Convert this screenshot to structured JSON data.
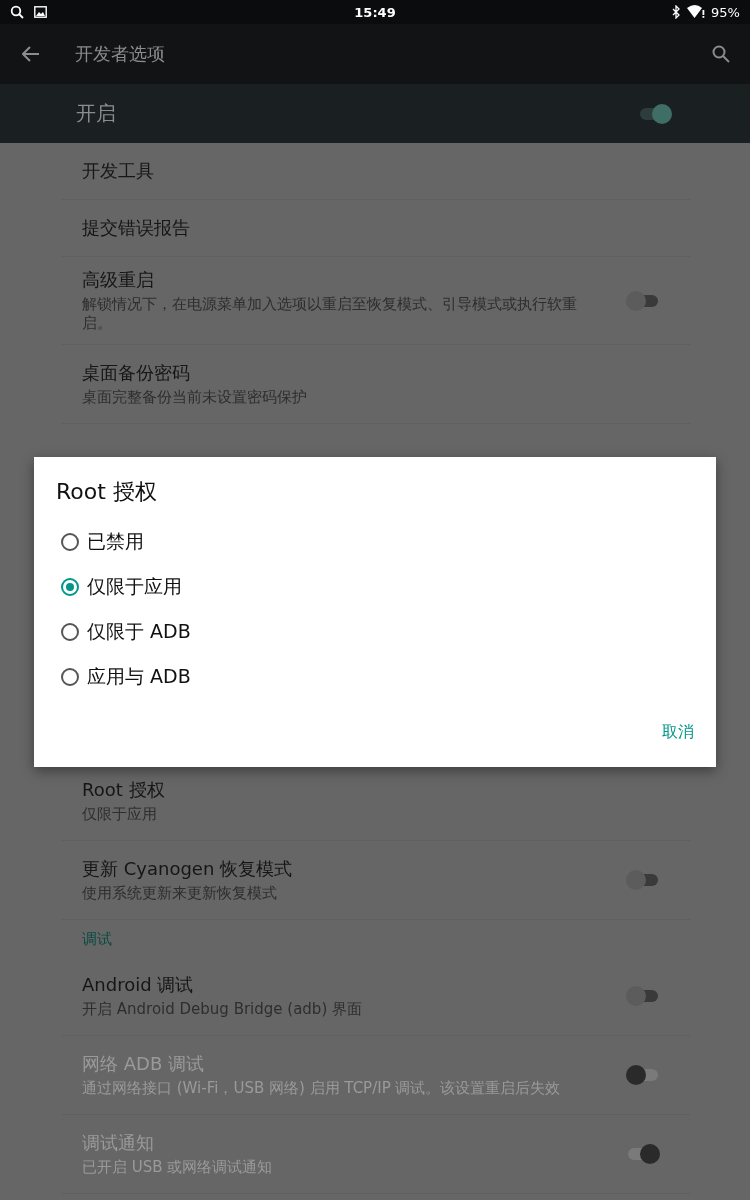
{
  "status_bar": {
    "time": "15:49",
    "battery": "95%"
  },
  "toolbar": {
    "title": "开发者选项"
  },
  "master_switch": {
    "label": "开启",
    "on": true
  },
  "settings": [
    {
      "kind": "row",
      "title": "开发工具"
    },
    {
      "kind": "row",
      "title": "提交错误报告"
    },
    {
      "kind": "switch",
      "title": "高级重启",
      "summary": "解锁情况下，在电源菜单加入选项以重启至恢复模式、引导模式或执行软重启。",
      "on": false,
      "disabled": false
    },
    {
      "kind": "row",
      "title": "桌面备份密码",
      "summary": "桌面完整备份当前未设置密码保护"
    },
    {
      "kind": "hidden"
    },
    {
      "kind": "row",
      "title": "Root 授权",
      "summary": "仅限于应用"
    },
    {
      "kind": "switch",
      "title": "更新 Cyanogen 恢复模式",
      "summary": "使用系统更新来更新恢复模式",
      "on": false,
      "disabled": false
    },
    {
      "kind": "category",
      "title": "调试"
    },
    {
      "kind": "switch",
      "title": "Android 调试",
      "summary": "开启 Android Debug Bridge (adb) 界面",
      "on": false,
      "disabled": false
    },
    {
      "kind": "switch",
      "title": "网络 ADB 调试",
      "summary": "通过网络接口 (Wi-Fi，USB 网络) 启用 TCP/IP 调试。该设置重启后失效",
      "on": false,
      "disabled": true
    },
    {
      "kind": "switch",
      "title": "调试通知",
      "summary": "已开启 USB 或网络调试通知",
      "on": true,
      "disabled": true
    }
  ],
  "dialog": {
    "title": "Root 授权",
    "options": [
      {
        "label": "已禁用",
        "selected": false
      },
      {
        "label": "仅限于应用",
        "selected": true
      },
      {
        "label": "仅限于 ADB",
        "selected": false
      },
      {
        "label": "应用与 ADB",
        "selected": false
      }
    ],
    "button": "取消"
  }
}
